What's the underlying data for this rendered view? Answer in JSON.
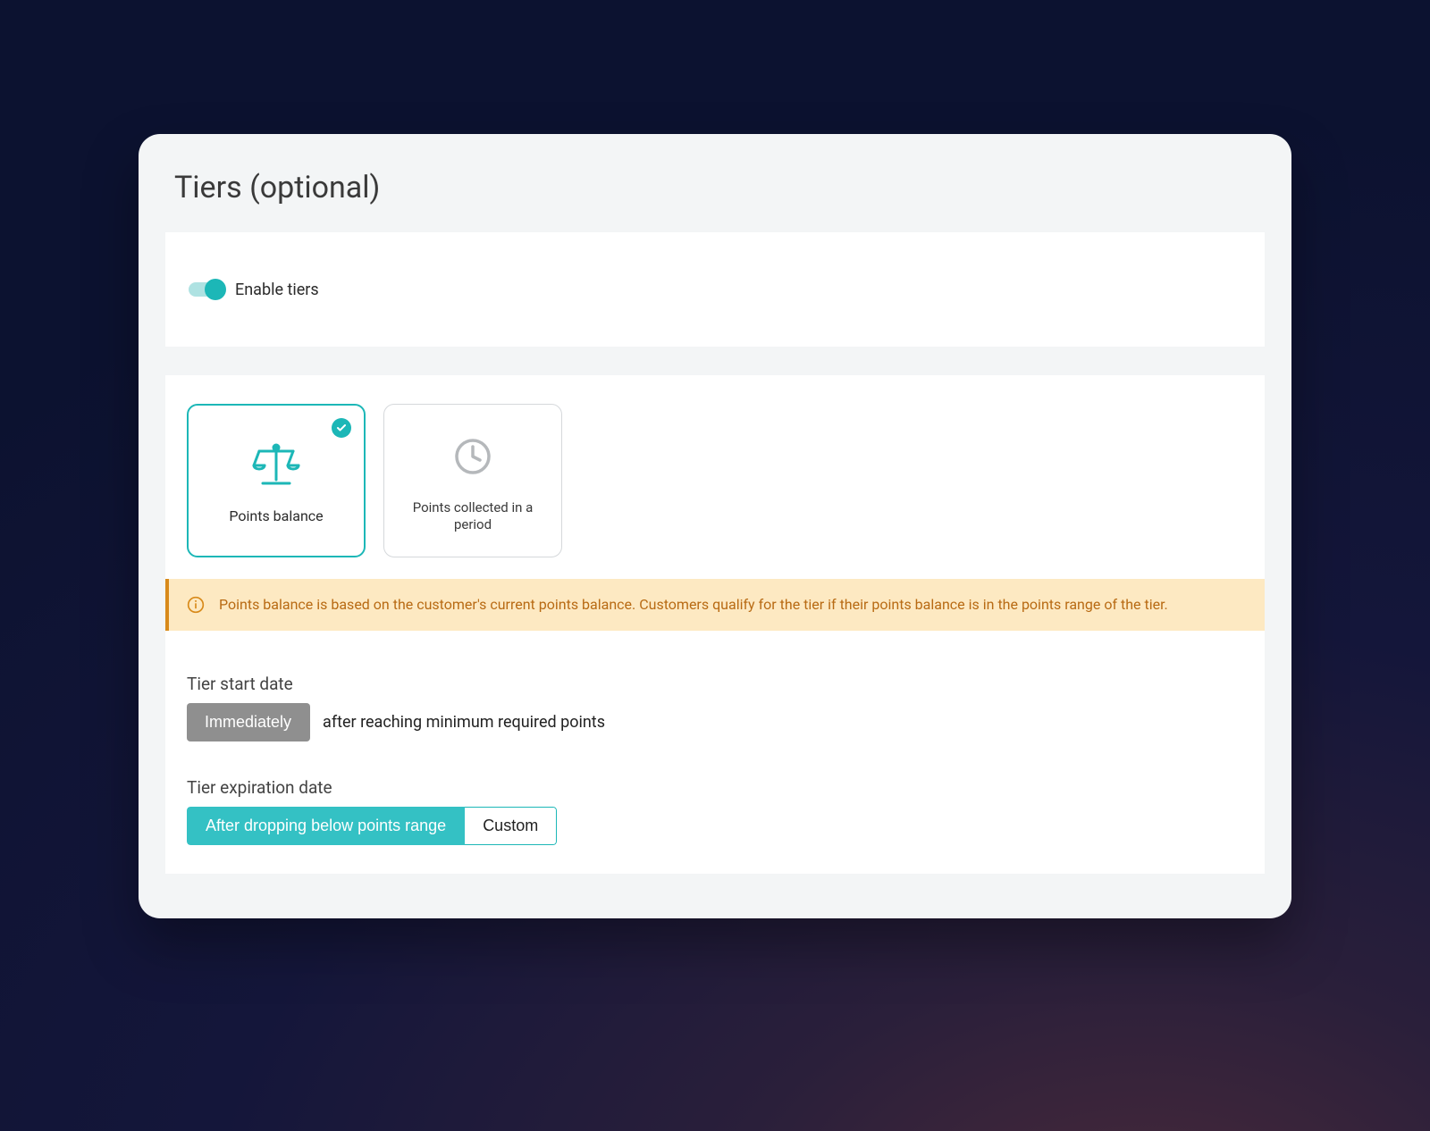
{
  "title": "Tiers (optional)",
  "enable": {
    "label": "Enable tiers",
    "on": true
  },
  "options": [
    {
      "id": "points-balance",
      "label": "Points balance",
      "selected": true,
      "icon": "scale"
    },
    {
      "id": "points-period",
      "label": "Points collected in a period",
      "selected": false,
      "icon": "clock"
    }
  ],
  "banner": {
    "text": "Points balance is based on the customer's current points balance. Customers qualify for the tier if their points balance is in the points range of the tier."
  },
  "start": {
    "label": "Tier start date",
    "button": "Immediately",
    "suffix": "after reaching minimum required points"
  },
  "expire": {
    "label": "Tier expiration date",
    "option_a": "After dropping below points range",
    "option_b": "Custom"
  },
  "colors": {
    "accent": "#1cb7b7",
    "banner_bg": "#fde9c2",
    "banner_border": "#d88a1a",
    "banner_text": "#b86a13"
  }
}
